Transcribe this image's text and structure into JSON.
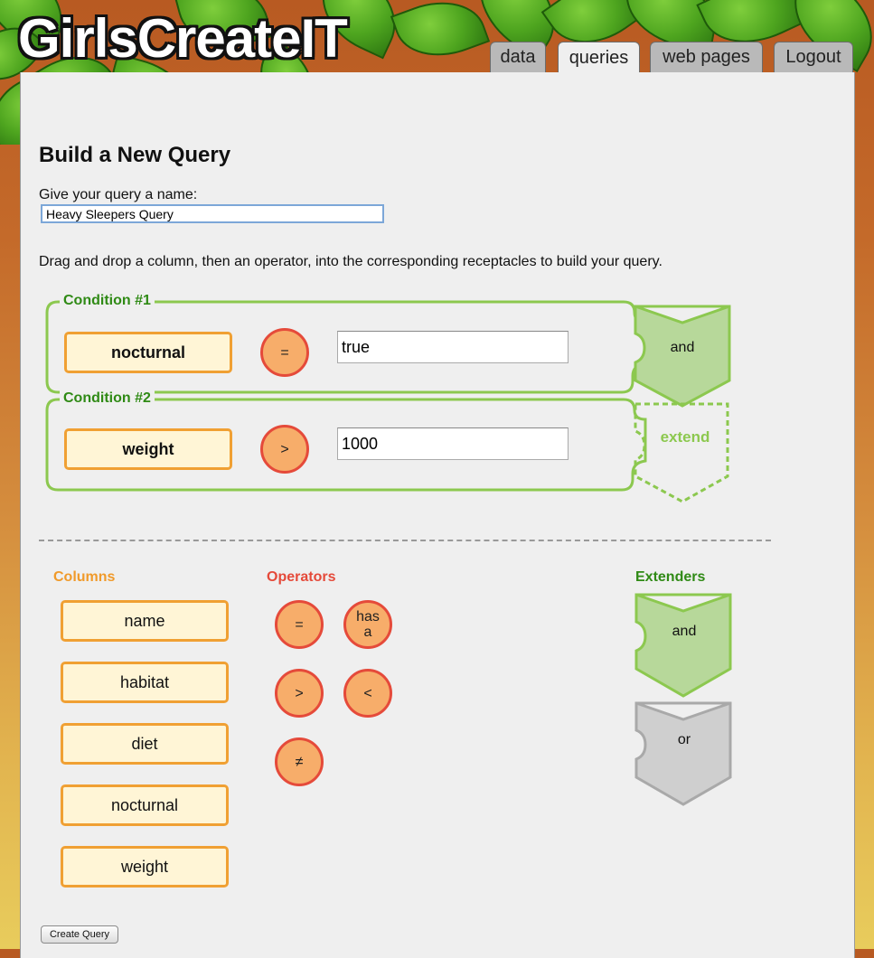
{
  "app": {
    "logo": "GirlsCreateIT"
  },
  "tabs": [
    {
      "label": "data",
      "active": false
    },
    {
      "label": "queries",
      "active": true
    },
    {
      "label": "web pages",
      "active": false
    },
    {
      "label": "Logout",
      "active": false
    }
  ],
  "page": {
    "title": "Build a New Query",
    "name_label": "Give your query a name:",
    "query_name": "Heavy Sleepers Query",
    "instructions": "Drag and drop a column, then an operator, into the corresponding receptacles to build your query."
  },
  "conditions": [
    {
      "title": "Condition #1",
      "column": "nocturnal",
      "operator": "=",
      "value": "true",
      "extender": "and"
    },
    {
      "title": "Condition #2",
      "column": "weight",
      "operator": ">",
      "value": "1000",
      "extender": "extend"
    }
  ],
  "palette": {
    "columns_heading": "Columns",
    "columns": [
      "name",
      "habitat",
      "diet",
      "nocturnal",
      "weight"
    ],
    "operators_heading": "Operators",
    "operators": [
      "=",
      "has a",
      ">",
      "<",
      "≠"
    ],
    "extenders_heading": "Extenders",
    "extenders": [
      "and",
      "or"
    ]
  },
  "actions": {
    "create_label": "Create Query"
  },
  "colors": {
    "condition_green": "#7dc242",
    "column_orange": "#f0a033",
    "operator_red": "#e54a3a",
    "extender_and": "#b7d89a",
    "extender_or": "#cfcfcf"
  }
}
